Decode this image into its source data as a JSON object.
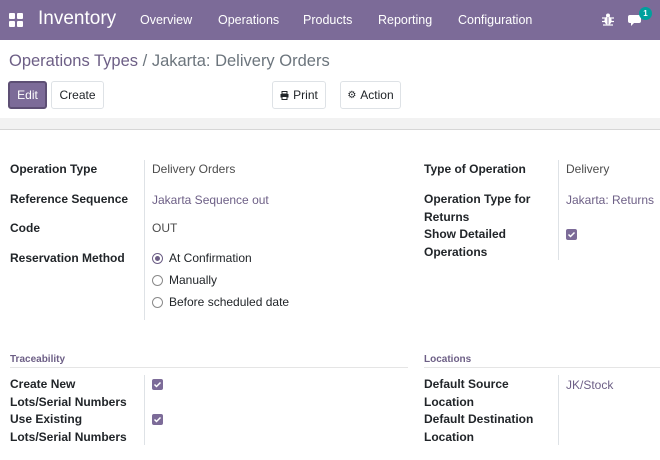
{
  "navbar": {
    "app_name": "Inventory",
    "menu": [
      "Overview",
      "Operations",
      "Products",
      "Reporting",
      "Configuration"
    ],
    "notification_count": "1",
    "bg_color": "#7c6b98"
  },
  "breadcrumb": {
    "parent": "Operations Types",
    "separator": "/",
    "current": "Jakarta: Delivery Orders"
  },
  "buttons": {
    "edit": "Edit",
    "create": "Create",
    "print": "Print",
    "action": "Action"
  },
  "fields": {
    "operation_type": {
      "label": "Operation Type",
      "value": "Delivery Orders"
    },
    "reference_sequence": {
      "label": "Reference Sequence",
      "value": "Jakarta Sequence out"
    },
    "code": {
      "label": "Code",
      "value": "OUT"
    },
    "reservation_method": {
      "label": "Reservation Method",
      "options": [
        "At Confirmation",
        "Manually",
        "Before scheduled date"
      ],
      "selected": "At Confirmation"
    },
    "type_of_operation": {
      "label": "Type of Operation",
      "value": "Delivery"
    },
    "return_type": {
      "label_line1": "Operation Type for",
      "label_line2": "Returns",
      "value": "Jakarta: Returns"
    },
    "show_detailed": {
      "label_line1": "Show Detailed",
      "label_line2": "Operations",
      "checked": true
    }
  },
  "traceability": {
    "title": "Traceability",
    "create_new": {
      "label_line1": "Create New",
      "label_line2": "Lots/Serial Numbers",
      "checked": true
    },
    "use_existing": {
      "label_line1": "Use Existing",
      "label_line2": "Lots/Serial Numbers",
      "checked": true
    }
  },
  "locations": {
    "title": "Locations",
    "default_source": {
      "label_line1": "Default Source",
      "label_line2": "Location",
      "value": "JK/Stock"
    },
    "default_destination": {
      "label_line1": "Default Destination",
      "label_line2": "Location",
      "value": ""
    }
  },
  "icons": {
    "apps": "apps-grid-icon",
    "debug": "bug-icon",
    "messages": "chat-icon",
    "print": "print-icon",
    "action": "gear-icon"
  }
}
